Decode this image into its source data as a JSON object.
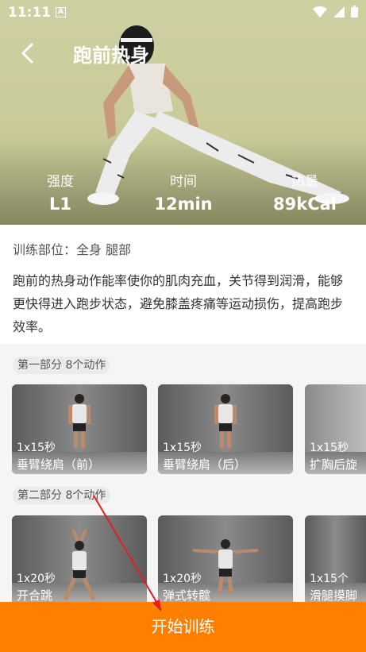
{
  "status_bar": {
    "time": "11:11",
    "badge": "A"
  },
  "header": {
    "title": "跑前热身"
  },
  "stats": [
    {
      "label": "强度",
      "value": "L1"
    },
    {
      "label": "时间",
      "value": "12min"
    },
    {
      "label": "热量",
      "value": "89kCal"
    }
  ],
  "info": {
    "parts": "训练部位：全身 腿部",
    "description": "跑前的热身动作能率使你的肌肉充血，关节得到润滑，能够更快得进入跑步状态，避免膝盖疼痛等运动损伤，提高跑步效率。"
  },
  "sections": [
    {
      "title": "第一部分 8个动作",
      "exercises": [
        {
          "count": "1x15秒",
          "name": "垂臂绕肩（前）"
        },
        {
          "count": "1x15秒",
          "name": "垂臂绕肩（后）"
        },
        {
          "count": "1x15秒",
          "name": "扩胸后旋"
        }
      ]
    },
    {
      "title": "第二部分 8个动作",
      "exercises": [
        {
          "count": "1x20秒",
          "name": "开合跳"
        },
        {
          "count": "1x20秒",
          "name": "弹式转髋"
        },
        {
          "count": "1x15个",
          "name": "滑腿摸脚"
        }
      ]
    }
  ],
  "footer": {
    "start_label": "开始训练"
  },
  "colors": {
    "accent": "#ff8000",
    "annotation": "#e02020"
  }
}
